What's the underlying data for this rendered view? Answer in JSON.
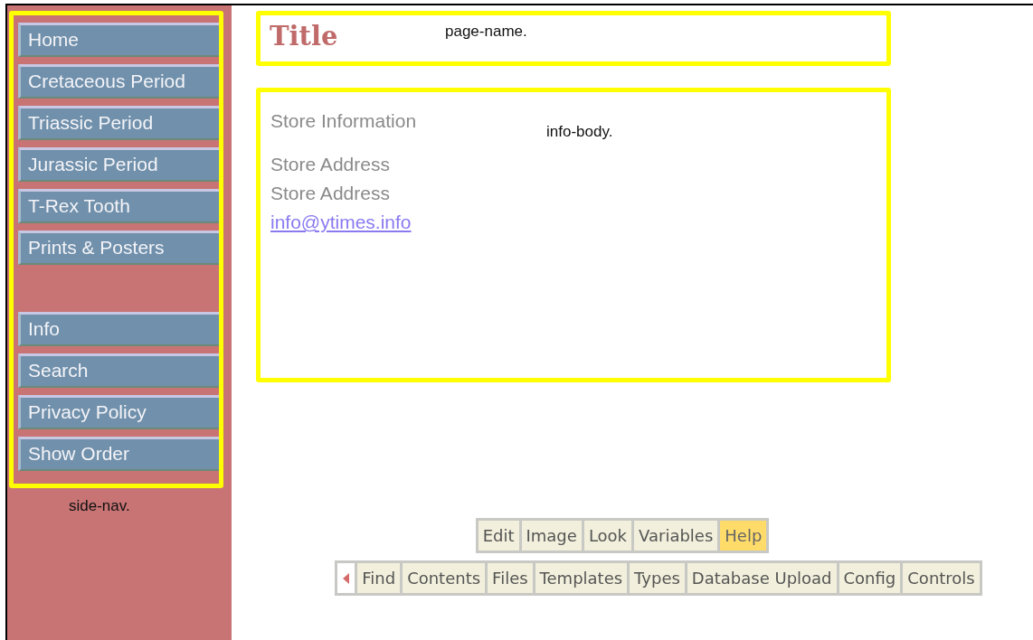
{
  "side_nav": {
    "groups": [
      {
        "items": [
          {
            "label": "Home"
          },
          {
            "label": "Cretaceous Period"
          },
          {
            "label": "Triassic Period"
          },
          {
            "label": "Jurassic Period"
          },
          {
            "label": "T-Rex Tooth"
          },
          {
            "label": "Prints & Posters"
          }
        ]
      },
      {
        "items": [
          {
            "label": "Info"
          },
          {
            "label": "Search"
          },
          {
            "label": "Privacy Policy"
          },
          {
            "label": "Show Order"
          }
        ]
      }
    ],
    "caption": "side-nav."
  },
  "page_name": {
    "title": "Title",
    "caption": "page-name."
  },
  "info_body": {
    "heading": "Store Information",
    "caption": "info-body.",
    "address_lines": [
      "Store Address",
      "Store Address"
    ],
    "email": "info@ytimes.info"
  },
  "toolbar_top": [
    {
      "label": "Edit",
      "selected": false
    },
    {
      "label": "Image",
      "selected": false
    },
    {
      "label": "Look",
      "selected": false
    },
    {
      "label": "Variables",
      "selected": false
    },
    {
      "label": "Help",
      "selected": true
    }
  ],
  "toolbar_bottom": [
    {
      "label": "Find",
      "selected": false
    },
    {
      "label": "Contents",
      "selected": false
    },
    {
      "label": "Files",
      "selected": false
    },
    {
      "label": "Templates",
      "selected": false
    },
    {
      "label": "Types",
      "selected": false
    },
    {
      "label": "Database Upload",
      "selected": false
    },
    {
      "label": "Config",
      "selected": false
    },
    {
      "label": "Controls",
      "selected": false
    }
  ]
}
